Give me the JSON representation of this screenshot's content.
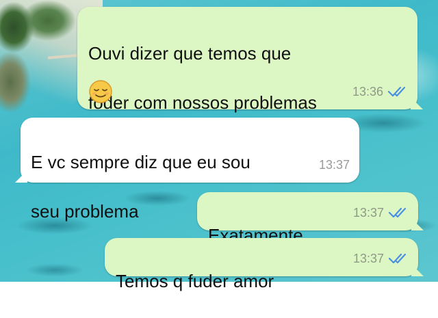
{
  "conversation": {
    "messages": [
      {
        "direction": "outgoing",
        "lines": [
          "Ouvi dizer que temos que",
          "foder com nossos problemas"
        ],
        "emoji": "relieved-face",
        "time": "13:36",
        "status": "read"
      },
      {
        "direction": "incoming",
        "lines": [
          "E vc sempre diz que eu sou",
          "seu problema"
        ],
        "time": "13:37"
      },
      {
        "direction": "outgoing",
        "lines": [
          "Exatamente"
        ],
        "time": "13:37",
        "status": "read"
      },
      {
        "direction": "outgoing",
        "lines": [
          "Temos q fuder amor"
        ],
        "time": "13:37",
        "status": "read"
      }
    ]
  },
  "colors": {
    "outgoing_bubble": "#dcf6c4",
    "incoming_bubble": "#ffffff",
    "read_check": "#4a90e2",
    "timestamp": "#8e9a86"
  }
}
